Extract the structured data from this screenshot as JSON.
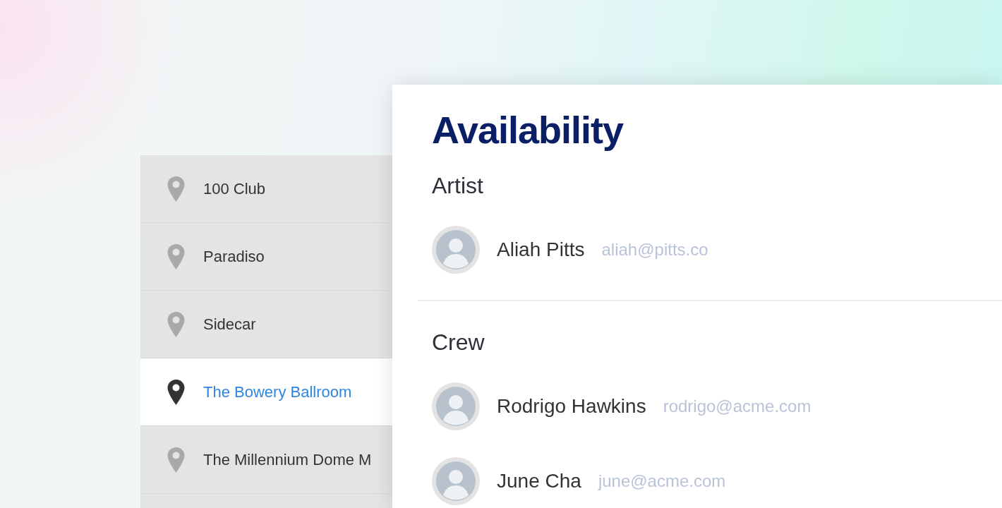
{
  "venues": [
    {
      "name": "100 Club",
      "selected": false
    },
    {
      "name": "Paradiso",
      "selected": false
    },
    {
      "name": "Sidecar",
      "selected": false
    },
    {
      "name": "The Bowery Ballroom",
      "selected": true
    },
    {
      "name": "The Millennium Dome M",
      "selected": false
    },
    {
      "selected": false
    }
  ],
  "panel": {
    "title": "Availability",
    "sections": [
      {
        "heading": "Artist",
        "people": [
          {
            "name": "Aliah Pitts",
            "email": "aliah@pitts.co"
          }
        ]
      },
      {
        "heading": "Crew",
        "people": [
          {
            "name": "Rodrigo Hawkins",
            "email": "rodrigo@acme.com"
          },
          {
            "name": "June Cha",
            "email": "june@acme.com"
          }
        ]
      }
    ]
  }
}
